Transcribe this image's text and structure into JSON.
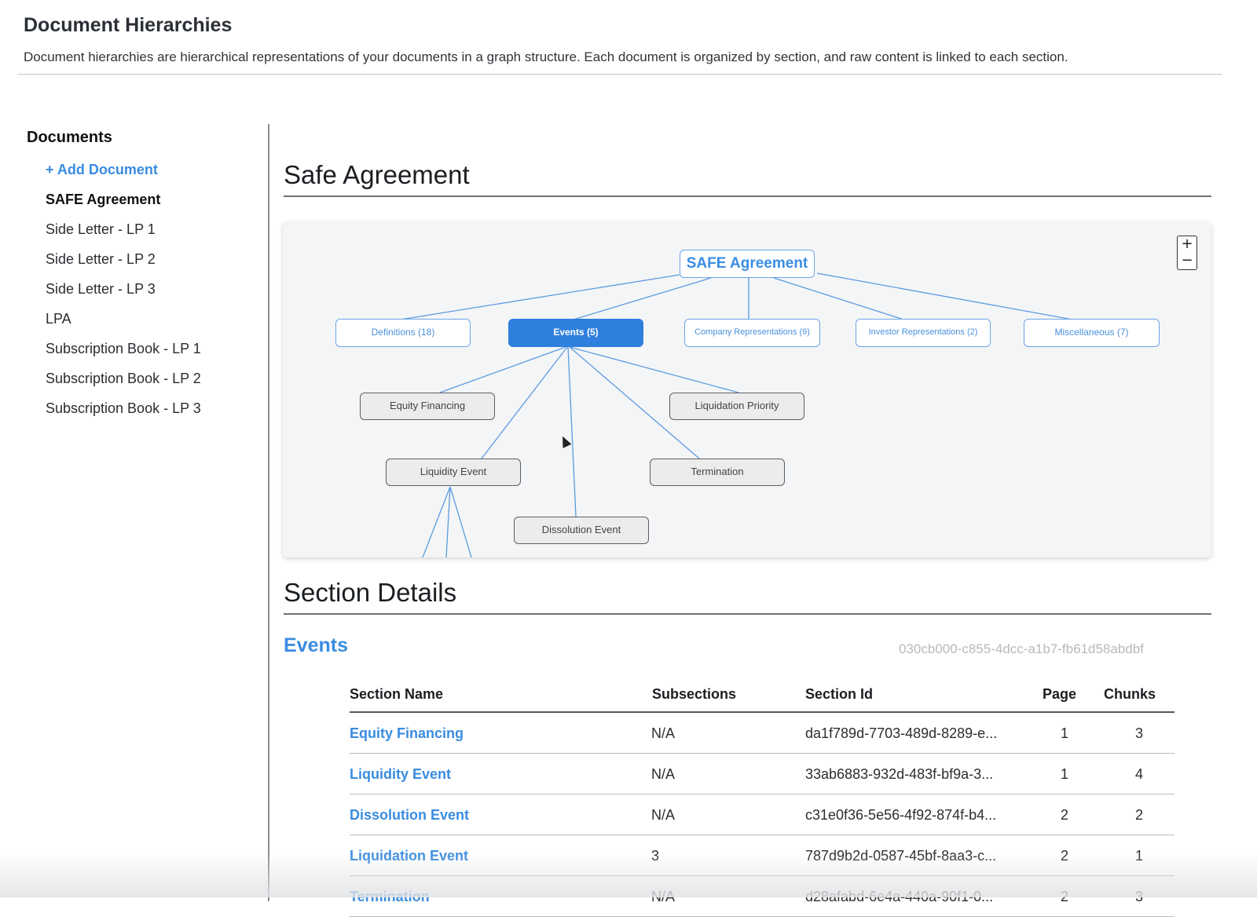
{
  "header": {
    "title": "Document Hierarchies",
    "description": "Document hierarchies are hierarchical representations of your documents in a graph structure. Each document is organized by section, and raw content is linked to each section."
  },
  "sidebar": {
    "title": "Documents",
    "add_label": "+ Add Document",
    "items": [
      {
        "label": "SAFE Agreement",
        "active": true
      },
      {
        "label": "Side Letter - LP 1"
      },
      {
        "label": "Side Letter - LP 2"
      },
      {
        "label": "Side Letter - LP 3"
      },
      {
        "label": "LPA"
      },
      {
        "label": "Subscription Book - LP 1"
      },
      {
        "label": "Subscription Book - LP 2"
      },
      {
        "label": "Subscription Book - LP 3"
      }
    ]
  },
  "document": {
    "title": "Safe Agreement"
  },
  "graph": {
    "zoom_in": "+",
    "zoom_out": "−",
    "root": "SAFE Agreement",
    "level1": [
      {
        "label": "Definitions (18)"
      },
      {
        "label": "Events (5)",
        "selected": true
      },
      {
        "label": "Company Representations (9)"
      },
      {
        "label": "Investor Representations (2)"
      },
      {
        "label": "Miscellaneous (7)"
      }
    ],
    "level2": [
      {
        "label": "Equity Financing"
      },
      {
        "label": "Liquidation Priority"
      },
      {
        "label": "Liquidity Event"
      },
      {
        "label": "Termination"
      },
      {
        "label": "Dissolution Event"
      }
    ],
    "colors": {
      "accent": "#2f7fdd",
      "node_border": "#6aa5e6",
      "edge": "#5b9be0"
    }
  },
  "section_details": {
    "heading": "Section Details",
    "section_title": "Events",
    "section_id": "030cb000-c855-4dcc-a1b7-fb61d58abdbf",
    "columns": [
      "Section Name",
      "Subsections",
      "Section Id",
      "Page",
      "Chunks"
    ],
    "rows": [
      {
        "name": "Equity Financing",
        "subsections": "N/A",
        "id": "da1f789d-7703-489d-8289-e...",
        "page": "1",
        "chunks": "3"
      },
      {
        "name": "Liquidity Event",
        "subsections": "N/A",
        "id": "33ab6883-932d-483f-bf9a-3...",
        "page": "1",
        "chunks": "4"
      },
      {
        "name": "Dissolution Event",
        "subsections": "N/A",
        "id": "c31e0f36-5e56-4f92-874f-b4...",
        "page": "2",
        "chunks": "2"
      },
      {
        "name": "Liquidation Event",
        "subsections": "3",
        "id": "787d9b2d-0587-45bf-8aa3-c...",
        "page": "2",
        "chunks": "1"
      },
      {
        "name": "Termination",
        "subsections": "N/A",
        "id": "d28afabd-6e4a-440a-90f1-0...",
        "page": "2",
        "chunks": "3"
      }
    ]
  }
}
